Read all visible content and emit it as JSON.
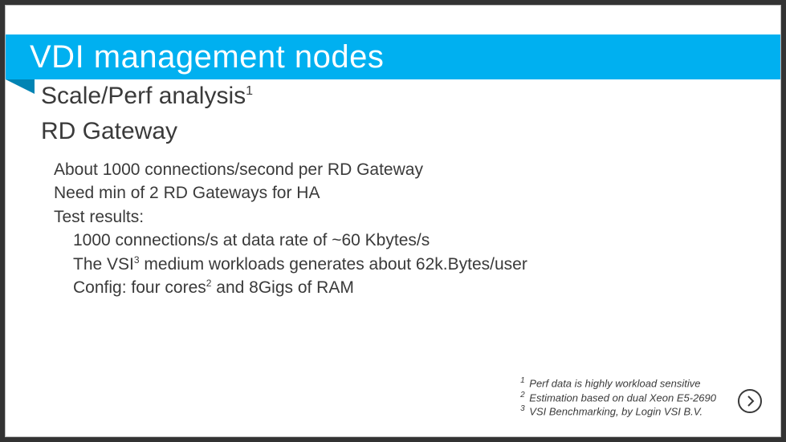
{
  "title": "VDI management nodes",
  "subtitle": {
    "text": "Scale/Perf analysis",
    "sup": "1"
  },
  "section_head": "RD Gateway",
  "body": {
    "l1": "About 1000 connections/second per RD Gateway",
    "l2": "Need min of 2 RD Gateways for HA",
    "l3": "Test results:",
    "l4": "1000 connections/s at data rate of ~60 Kbytes/s",
    "l5_pre": "The VSI",
    "l5_sup": "3",
    "l5_post": " medium workloads generates about 62k.Bytes/user",
    "l6_pre": "Config: four cores",
    "l6_sup": "2",
    "l6_post": " and 8Gigs of RAM"
  },
  "footnotes": {
    "f1_sup": "1",
    "f1": "Perf data is highly workload sensitive",
    "f2_sup": "2",
    "f2": "Estimation based on dual Xeon E5-2690",
    "f3_sup": "3",
    "f3": "VSI Benchmarking, by Login VSI B.V."
  }
}
